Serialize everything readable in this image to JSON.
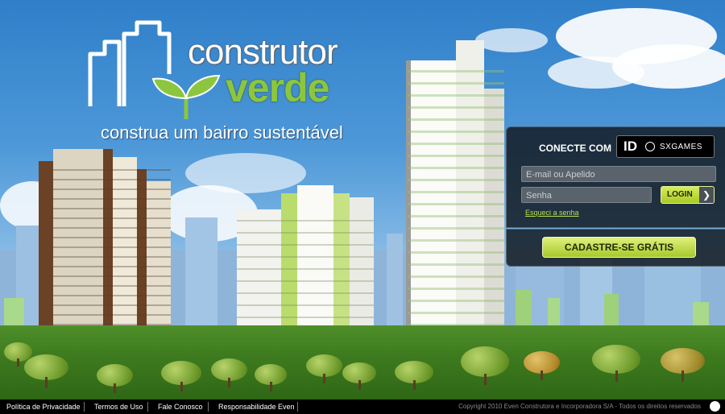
{
  "brand": {
    "word1": "construtor",
    "word2": "verde",
    "tagline": "construa um bairro sustentável",
    "accent_color": "#8cc63f"
  },
  "login": {
    "connect_label": "CONECTE COM",
    "id_badge": "ID",
    "id_provider": "SXGAMES",
    "email_placeholder": "E-mail ou Apelido",
    "password_placeholder": "Senha",
    "login_label": "LOGIN",
    "login_arrow_icon": "chevron-right-icon",
    "forgot_label": "Esqueci a senha"
  },
  "signup": {
    "label": "CADASTRE-SE GRÁTIS"
  },
  "footer": {
    "links": [
      "Política de Privacidade",
      "Termos de Uso",
      "Fale Conosco",
      "Responsabilidade Even"
    ],
    "copyright": "Copyright 2010 Even Construtora e Incorporadora S/A - Todos os direitos reservados",
    "logo_icon": "even-logo-icon"
  }
}
